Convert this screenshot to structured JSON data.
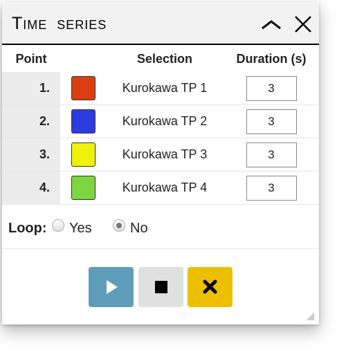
{
  "window": {
    "title": "Time series"
  },
  "table": {
    "headers": {
      "point": "Point",
      "selection": "Selection",
      "duration": "Duration (s)"
    },
    "rows": [
      {
        "point": "1.",
        "color": "#db3f10",
        "selection": "Kurokawa TP 1",
        "duration": "3"
      },
      {
        "point": "2.",
        "color": "#2d3ce0",
        "selection": "Kurokawa TP 2",
        "duration": "3"
      },
      {
        "point": "3.",
        "color": "#f1f20a",
        "selection": "Kurokawa TP 3",
        "duration": "3"
      },
      {
        "point": "4.",
        "color": "#7bd63f",
        "selection": "Kurokawa TP 4",
        "duration": "3"
      }
    ]
  },
  "loop": {
    "label": "Loop:",
    "options": [
      {
        "label": "Yes",
        "selected": false
      },
      {
        "label": "No",
        "selected": true
      }
    ]
  },
  "controls": {
    "play_icon": "play-icon",
    "stop_icon": "stop-icon",
    "clear_icon": "close-icon",
    "colors": {
      "play": "#5f9eba",
      "stop": "#e0e0e0",
      "clear": "#ecc000"
    }
  }
}
